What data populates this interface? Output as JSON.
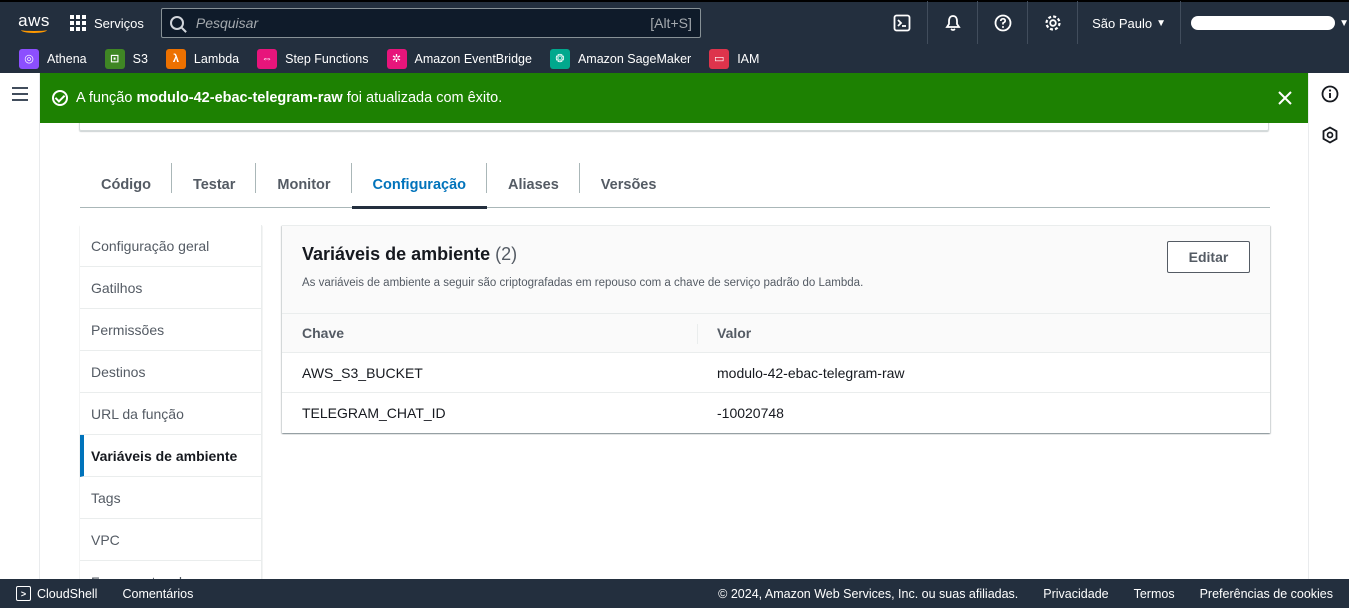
{
  "topnav": {
    "logo_text": "aws",
    "services_label": "Serviços",
    "search_placeholder": "Pesquisar",
    "search_shortcut": "[Alt+S]",
    "region": "São Paulo"
  },
  "favorites": [
    {
      "label": "Athena",
      "color": "#8c4fff"
    },
    {
      "label": "S3",
      "color": "#3f8624"
    },
    {
      "label": "Lambda",
      "color": "#ed7100"
    },
    {
      "label": "Step Functions",
      "color": "#e7157b"
    },
    {
      "label": "Amazon EventBridge",
      "color": "#e7157b"
    },
    {
      "label": "Amazon SageMaker",
      "color": "#01a88d"
    },
    {
      "label": "IAM",
      "color": "#dd344c"
    }
  ],
  "flash": {
    "prefix": "A função",
    "function_name": "modulo-42-ebac-telegram-raw",
    "suffix": "foi atualizada com êxito."
  },
  "tabs": [
    "Código",
    "Testar",
    "Monitor",
    "Configuração",
    "Aliases",
    "Versões"
  ],
  "sidenav": [
    "Configuração geral",
    "Gatilhos",
    "Permissões",
    "Destinos",
    "URL da função",
    "Variáveis de ambiente",
    "Tags",
    "VPC",
    "Ferramentas de"
  ],
  "panel": {
    "title": "Variáveis de ambiente",
    "count": "(2)",
    "description": "As variáveis de ambiente a seguir são criptografadas em repouso com a chave de serviço padrão do Lambda.",
    "edit_label": "Editar",
    "col_key": "Chave",
    "col_value": "Valor",
    "rows": [
      {
        "key": "AWS_S3_BUCKET",
        "value": "modulo-42-ebac-telegram-raw"
      },
      {
        "key": "TELEGRAM_CHAT_ID",
        "value": "-10020748"
      }
    ]
  },
  "footer": {
    "cloudshell": "CloudShell",
    "comments": "Comentários",
    "copyright": "© 2024, Amazon Web Services, Inc. ou suas afiliadas.",
    "privacy": "Privacidade",
    "terms": "Termos",
    "cookies": "Preferências de cookies"
  }
}
